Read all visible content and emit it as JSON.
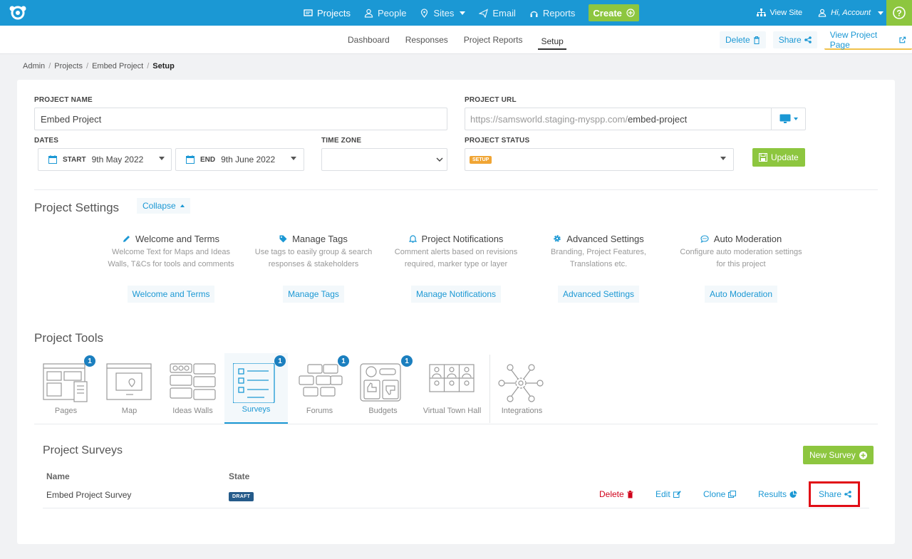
{
  "topnav": {
    "items": [
      {
        "label": "Projects",
        "icon": "projects-icon"
      },
      {
        "label": "People",
        "icon": "user-icon"
      },
      {
        "label": "Sites",
        "icon": "pin-icon"
      },
      {
        "label": "Email",
        "icon": "send-icon"
      },
      {
        "label": "Reports",
        "icon": "reports-icon"
      }
    ],
    "create_label": "Create",
    "view_site": "View Site",
    "account": "Hi, Account",
    "help": "?",
    "brand_color": "#1b98d4",
    "accent_color": "#8dc63f"
  },
  "subnav": {
    "tabs": [
      "Dashboard",
      "Responses",
      "Project Reports",
      "Setup"
    ],
    "active_tab": "Setup",
    "delete_label": "Delete",
    "share_label": "Share",
    "view_page_label": "View Project Page"
  },
  "breadcrumb": [
    "Admin",
    "Projects",
    "Embed Project",
    "Setup"
  ],
  "form": {
    "project_name_label": "PROJECT NAME",
    "project_name_value": "Embed Project",
    "project_url_label": "PROJECT URL",
    "project_url_base": "https://samsworld.staging-myspp.com/",
    "project_url_slug": "embed-project",
    "dates_label": "DATES",
    "start_label": "START",
    "start_value": "9th May 2022",
    "end_label": "END",
    "end_value": "9th June 2022",
    "time_zone_label": "TIME ZONE",
    "project_status_label": "PROJECT STATUS",
    "project_status_value": "SETUP",
    "update_label": "Update"
  },
  "settings": {
    "title": "Project Settings",
    "collapse_label": "Collapse",
    "items": [
      {
        "title": "Welcome and Terms",
        "desc1": "Welcome Text for Maps and Ideas",
        "desc2": "Walls, T&Cs for tools and comments",
        "button": "Welcome and Terms",
        "icon": "pencil-icon"
      },
      {
        "title": "Manage Tags",
        "desc1": "Use tags to easily group & search",
        "desc2": "responses & stakeholders",
        "button": "Manage Tags",
        "icon": "tag-icon"
      },
      {
        "title": "Project Notifications",
        "desc1": "Comment alerts based on revisions",
        "desc2": "required, marker type or layer",
        "button": "Manage Notifications",
        "icon": "bell-icon"
      },
      {
        "title": "Advanced Settings",
        "desc1": "Branding, Project Features,",
        "desc2": "Translations etc.",
        "button": "Advanced Settings",
        "icon": "gear-icon"
      },
      {
        "title": "Auto Moderation",
        "desc1": "Configure auto moderation settings",
        "desc2": "for this project",
        "button": "Auto Moderation",
        "icon": "chat-icon"
      }
    ]
  },
  "tools": {
    "title": "Project Tools",
    "items": [
      {
        "label": "Pages",
        "count": "1"
      },
      {
        "label": "Map",
        "count": ""
      },
      {
        "label": "Ideas Walls",
        "count": ""
      },
      {
        "label": "Surveys",
        "count": "1"
      },
      {
        "label": "Forums",
        "count": "1"
      },
      {
        "label": "Budgets",
        "count": "1"
      },
      {
        "label": "Virtual Town Hall",
        "count": ""
      },
      {
        "label": "Integrations",
        "count": ""
      }
    ],
    "active": "Surveys"
  },
  "surveys": {
    "title": "Project Surveys",
    "new_label": "New Survey",
    "col_name": "Name",
    "col_state": "State",
    "rows": [
      {
        "name": "Embed Project Survey",
        "state": "DRAFT"
      }
    ],
    "actions": {
      "delete": "Delete",
      "edit": "Edit",
      "clone": "Clone",
      "results": "Results",
      "share": "Share"
    }
  }
}
